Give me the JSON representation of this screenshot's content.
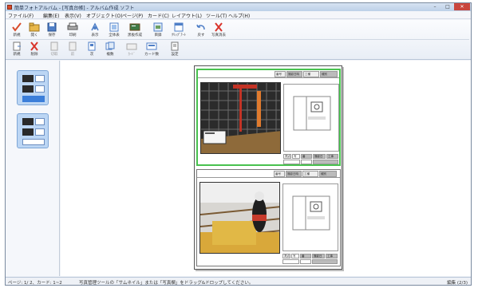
{
  "window": {
    "title": "簡単フォトアルバム - [写真台帳] - アルバム作成 ソフト"
  },
  "menu": [
    {
      "id": "file",
      "label": "ファイル(F)"
    },
    {
      "id": "edit",
      "label": "編集(E)"
    },
    {
      "id": "view",
      "label": "表示(V)"
    },
    {
      "id": "object",
      "label": "オブジェクト(O)"
    },
    {
      "id": "page",
      "label": "ページ(P)"
    },
    {
      "id": "card",
      "label": "カード(C)"
    },
    {
      "id": "layout",
      "label": "レイアウト(L)"
    },
    {
      "id": "tools",
      "label": "ツール(T)"
    },
    {
      "id": "help",
      "label": "ヘルプ(H)"
    }
  ],
  "toolbar_row1": [
    {
      "label": "新規",
      "icon": "new-icon",
      "enabled": true
    },
    {
      "label": "開く",
      "icon": "open-icon",
      "enabled": true
    },
    {
      "label": "保存",
      "icon": "save-icon",
      "enabled": true
    },
    {
      "label": "印刷",
      "icon": "print-icon",
      "enabled": true
    },
    {
      "label": "表示",
      "icon": "view-icon",
      "enabled": true
    },
    {
      "label": "全体表",
      "icon": "fit-icon",
      "enabled": true
    },
    {
      "label": "黒板作成",
      "icon": "blackboard-icon",
      "enabled": true
    },
    {
      "label": "目録",
      "icon": "catalog-icon",
      "enabled": true
    },
    {
      "label": "ｸﾘｯﾌﾟｱｰﾄ",
      "icon": "clipart-icon",
      "enabled": true
    },
    {
      "label": "戻す",
      "icon": "undo-icon",
      "enabled": true
    },
    {
      "label": "写真消去",
      "icon": "delete-photo-icon",
      "enabled": true
    }
  ],
  "toolbar_row2": [
    {
      "label": "新規",
      "icon": "new-page-icon",
      "enabled": true
    },
    {
      "label": "削除",
      "icon": "delete-icon",
      "enabled": true
    },
    {
      "label": "切取",
      "icon": "cut-icon",
      "enabled": false
    },
    {
      "label": "前",
      "icon": "prev-icon",
      "enabled": false
    },
    {
      "label": "次",
      "icon": "next-icon",
      "enabled": true
    },
    {
      "label": "複数",
      "icon": "multi-icon",
      "enabled": true
    },
    {
      "label": "ｶｰﾄﾞ",
      "icon": "card-icon",
      "enabled": false
    },
    {
      "label": "カード数",
      "icon": "card-count-icon",
      "enabled": true
    },
    {
      "label": "設定",
      "icon": "settings-icon",
      "enabled": true
    }
  ],
  "card_header": [
    "番号",
    "撮影日時",
    "工種",
    "種別"
  ],
  "card_footer": [
    "測点",
    "写",
    "番",
    "撮影日",
    "工事"
  ],
  "status": {
    "page_info": "ページ: 1/ 2、カード: 1~2",
    "hint": "写真管理ツールの「サムネイル」または「写真欄」をドラッグ&ドロップしてください。",
    "right": "編集 (2/3)"
  },
  "colors": {
    "selection": "#49c24f",
    "accent": "#3b7ed9",
    "close": "#c9463d"
  }
}
